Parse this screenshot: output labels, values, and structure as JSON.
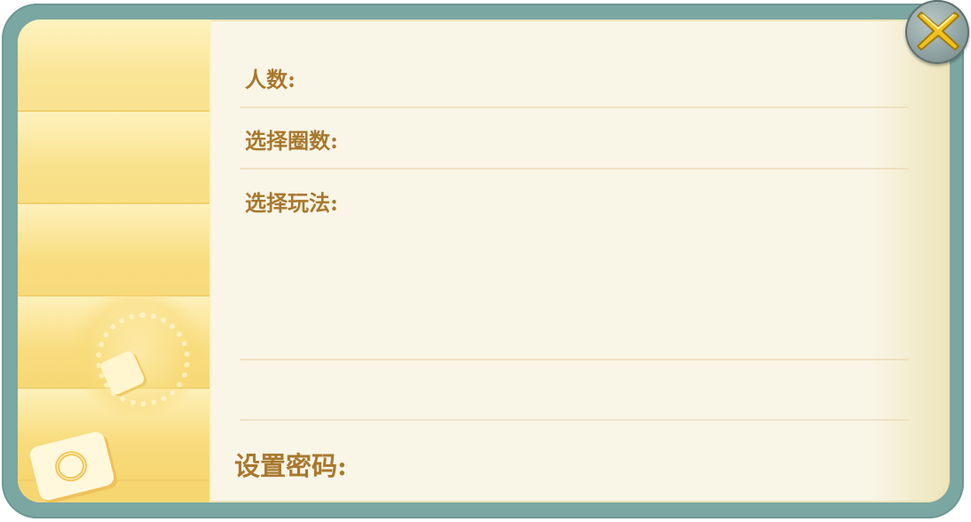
{
  "dialog": {
    "rows": {
      "players_label": "人数:",
      "rounds_label": "选择圈数:",
      "mode_label": "选择玩法:",
      "password_label": "设置密码:"
    },
    "close_icon": "close-x-icon",
    "colors": {
      "frame": "#7ba7a3",
      "panel": "#f9f6e8",
      "label": "#a8782e",
      "close_x": "#f2c31a"
    }
  }
}
